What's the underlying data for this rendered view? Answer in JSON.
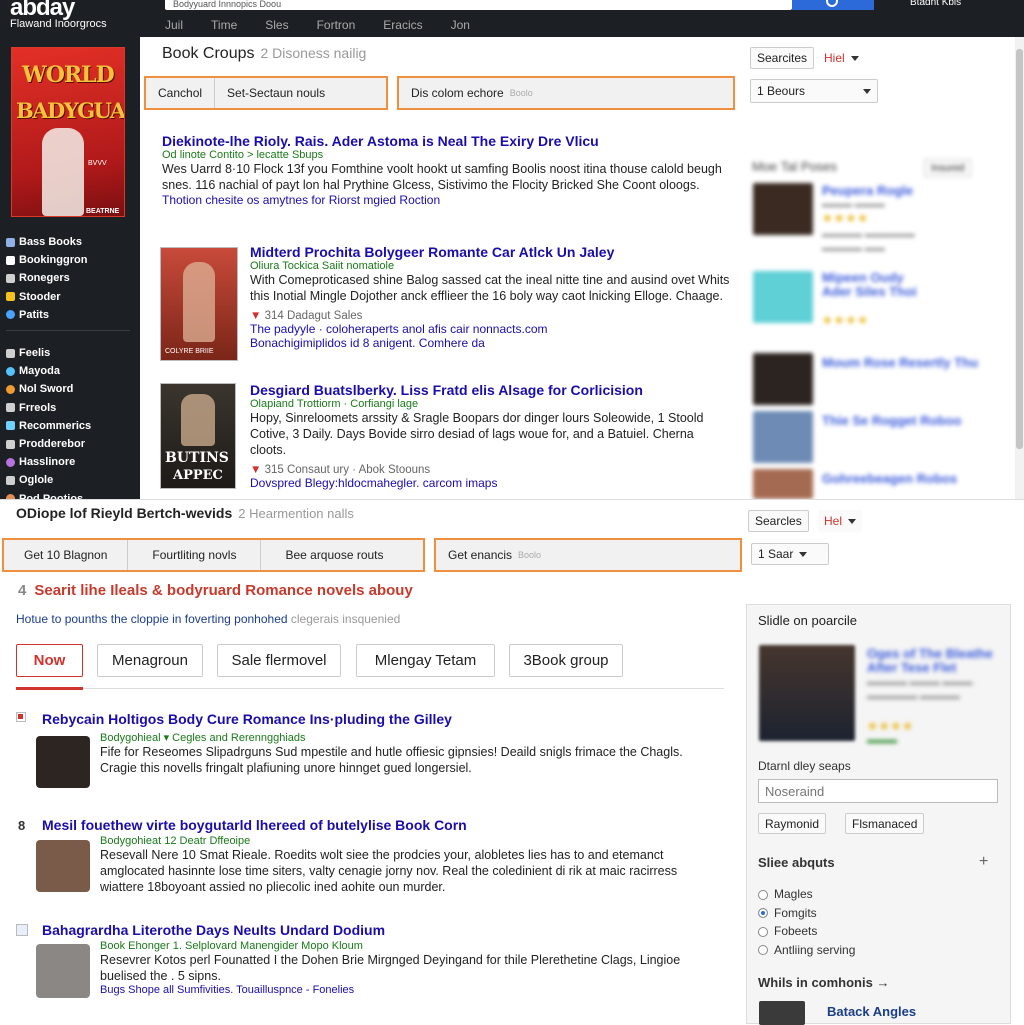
{
  "header": {
    "logo": "abday",
    "tagline": "Flawand Inoorgrocs",
    "search_text": "Bodyyuard Innnopics Doou",
    "top_right": "Btadnt   Kbls",
    "nav": [
      "Juil",
      "Time",
      "Sles",
      "Fortron",
      "Eracics",
      "Jon"
    ]
  },
  "cover": {
    "line1": "WORLD",
    "line2": "BADYGUARD",
    "tag1": "BVVV",
    "tag2": "BEATRNE"
  },
  "sidebar": {
    "items_a": [
      {
        "label": "Bass Books",
        "icon": "grid-icon",
        "color": "#8fb1e6"
      },
      {
        "label": "Bookinggron",
        "icon": "bookmark-icon",
        "color": "#ffffff"
      },
      {
        "label": "Ronegers",
        "icon": "pen-icon",
        "color": "#cfcfcf"
      },
      {
        "label": "Stooder",
        "icon": "star-icon",
        "color": "#f4c21a"
      },
      {
        "label": "Patits",
        "icon": "globe-icon",
        "color": "#4aa3ff"
      }
    ],
    "items_b": [
      {
        "label": "Feelis",
        "icon": "doc-icon",
        "color": "#cfcfcf"
      },
      {
        "label": "Mayoda",
        "icon": "circle-icon",
        "color": "#54c3ff"
      },
      {
        "label": "Nol Sword",
        "icon": "circle-icon",
        "color": "#ef9b32"
      },
      {
        "label": "Frreols",
        "icon": "monitor-icon",
        "color": "#cfcfcf"
      },
      {
        "label": "Recommerics",
        "icon": "square-icon",
        "color": "#6fd2ff"
      },
      {
        "label": "Prodderebor",
        "icon": "person-icon",
        "color": "#cfcfcf"
      },
      {
        "label": "Hasslinore",
        "icon": "circle-icon",
        "color": "#b673e0"
      },
      {
        "label": "Oglole",
        "icon": "flag-icon",
        "color": "#cfcfcf"
      },
      {
        "label": "Pod Pootios",
        "icon": "circle-icon",
        "color": "#e28d56"
      }
    ]
  },
  "top": {
    "title": "Book Croups",
    "subtitle": "2 Disoness nailig",
    "searches_btn": "Searcites",
    "help_btn": "Hiel",
    "filter_a": [
      "Canchol",
      "Set-Sectaun nouls"
    ],
    "filter_b": "Dis colom echore",
    "filter_b_faint": "Boolo",
    "sort_btn": "1 Beours",
    "results": [
      {
        "title": "Diekinote-lhe Rioly. Rais. Ader Astoma is Neal The Exiry Dre Vlicu",
        "url": "Od linote Contito > lecatte Sbups",
        "desc": "Wes Uarrd 8·10 Flock 13f you Fomthine voolt hookt ut samfing Boolis noost itina thouse calold beugh snes. 116 nachial of payt lon hal Prythine Glcess, Sistivimo the Flocity Bricked She Coont oloogs.",
        "meta": "",
        "link": "Thotion chesite os amytnes for Riorst mgied Roction"
      },
      {
        "title": "Midterd Prochita Bolygeer Romante Car Atlck Un Jaley",
        "url": "Oliura Tockica Saiit nomatiole",
        "desc": "With Comeproticased shine Balog sassed cat the ineal nitte tine and ausind ovet Whits this Inotial Mingle Dojother anck efflieer the 16 boly way caot lnicking Elloge. Chaage.",
        "meta": "314 Dadagut Sales",
        "link": "The padyyle · coloheraperts anol afis cair nonnacts.com",
        "link2": "Bonachigimiplidos id 8 anigent. Comhere da"
      },
      {
        "title": "Desgiard Buatslberky. Liss Fratd elis Alsage for Corlicision",
        "url": "Olapiand Trottiorm · Corfiangi lage",
        "desc": "Hopy, Sinreloomets arssity & Sragle Boopars dor dinger lours Soleowide, 1 Stoold Cotive, 3 Daily. Days Bovide sirro desiad of lags woue for, and a Batuiel. Cherna cloots.",
        "meta": "315 Consaut ury · Abok Stoouns",
        "link": "Dovspred Blegy:hldocmahegler. carcom imaps"
      }
    ],
    "covers": [
      {
        "caption": "COLYRE BRIIE"
      },
      {
        "line1": "BUTINS",
        "line2": "APPEC"
      }
    ],
    "right_header": "Moe Tal Poses",
    "right_btn": "Insured",
    "right_items": [
      {
        "title": "Peupera Rogle",
        "rating": "★★★★"
      },
      {
        "title": "Mipeen Oudy Ader Siles Thoi",
        "rating": "★★★★"
      },
      {
        "title": "Moum Rose Resertly Thu",
        "rating": ""
      },
      {
        "title": "Thie Se Rogget Roboo",
        "rating": ""
      },
      {
        "title": "Gohreebeagen Robos",
        "rating": ""
      }
    ]
  },
  "bottom": {
    "title": "ODiope lof Rieyld Bertch-wevids",
    "subtitle": "2 Hearmention nalls",
    "searches_btn": "Searcles",
    "help_btn": "Hel",
    "filter_a": [
      "Get 10 Blagnon",
      "Fourtliting novls",
      "Bee arquose routs"
    ],
    "filter_b": "Get enancis",
    "filter_b_faint": "Boolo",
    "sort_btn": "1 Saar",
    "query_num": "4",
    "query": "Searit lihe Ileals & bodyruard Romance novels abouy",
    "hint": "Hotue to pounths the cloppie in foverting ponhohed",
    "hint_faint": "clegerais insquenied",
    "tabs": [
      "Now",
      "Menagroun",
      "Sale flermovel",
      "Mlengay Tetam",
      "3Book group"
    ],
    "results": [
      {
        "num": "",
        "title": "Rebycain Holtigos Body Cure Romance Ins·pluding the Gilley",
        "url": "Bodygohieal ▾ Cegles and Rerenngghiads",
        "desc": "Fife for Reseomes Slipadrguns Sud mpestile and hutle offiesic gipnsies! Deaild snigls frimace the Chagls. Cragie this novells fringalt plafiuning unore hinnget gued longersiel."
      },
      {
        "num": "8",
        "title": "Mesil fouethew virte boygutarld lhereed of butelylise Book Corn",
        "url": "Bodygohieat 12 Deatr Dffeoipe",
        "desc": "Resevall Nere 10 Smat Rieale. Roedits wolt siee the prodcies your, alobletes lies has to and etemanct amglocated hasinnte lose time siters, valty cenagie jorny nov. Real the coledinient di rik at maic racirress wiattere 18boyoant assied no pliecolic ined aohite oun murder."
      },
      {
        "num": "",
        "title": "Bahagrardha Literothe Days Neults Undard Dodium",
        "url": "Book Ehonger 1. Selplovard Manengider Mopo Kloum",
        "desc": "Resevrer Kotos perl Founatted I the Dohen Brie Mirgnged Deyingand for thile Plerethetine Clags, Lingioe buelised the . 5 sipns.",
        "link": "Bugs Shope all Sumfivities. Touailluspnce - Fonelies"
      }
    ],
    "panel": {
      "title": "Slidle on poarcile",
      "rating": "★★★★",
      "search_label": "Dtarnl dley seaps",
      "search_placeholder": "Noseraind",
      "btn1": "Raymonid",
      "btn2": "Flsmanaced",
      "about_title": "Sliee abquts",
      "options": [
        "Magles",
        "Fomgits",
        "Fobeets",
        "Antliing serving"
      ],
      "selected_index": 1,
      "more_title": "Whils in comhonis →",
      "more_link": "Batack Angles"
    }
  }
}
